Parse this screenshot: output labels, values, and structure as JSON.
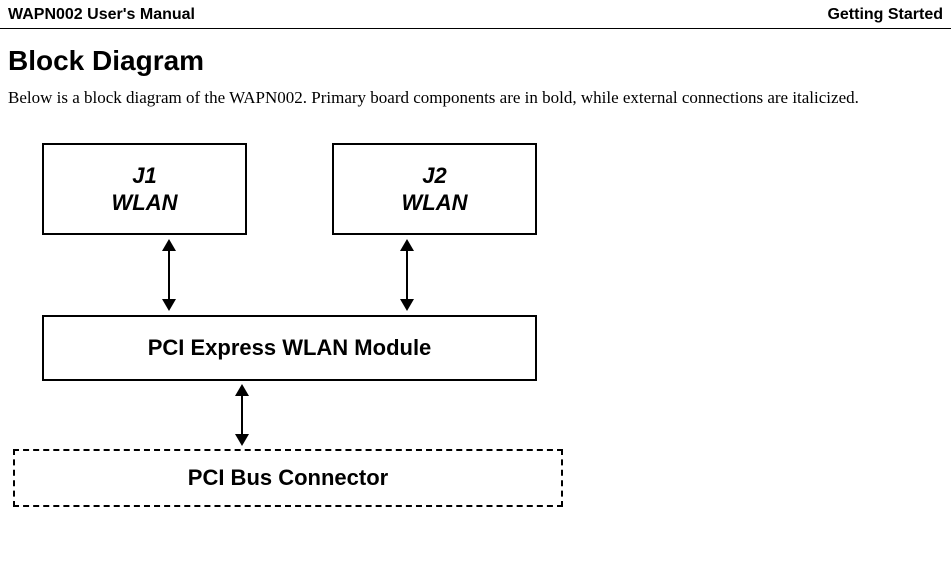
{
  "header": {
    "left": "WAPN002 User's Manual",
    "right": "Getting Started"
  },
  "section": {
    "title": "Block Diagram",
    "body": "Below is a block diagram of the WAPN002. Primary board components are in bold, while external connections are italicized."
  },
  "diagram": {
    "j1_line1": "J1",
    "j1_line2": "WLAN",
    "j2_line1": "J2",
    "j2_line2": "WLAN",
    "pci_express": "PCI Express WLAN Module",
    "pci_bus": "PCI Bus Connector"
  }
}
